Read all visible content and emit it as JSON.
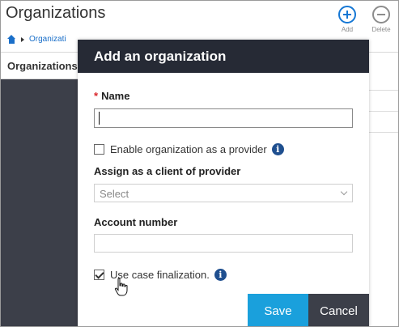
{
  "page": {
    "title": "Organizations",
    "breadcrumb": "Organizati",
    "side_tab": "Organizations"
  },
  "toolbar": {
    "add_label": "Add",
    "delete_label": "Delete"
  },
  "modal": {
    "title": "Add an organization",
    "name_label": "Name",
    "required_mark": "*",
    "name_value": "",
    "enable_provider_label": "Enable organization as a provider",
    "enable_provider_checked": false,
    "assign_client_label": "Assign as a client of provider",
    "assign_client_selected": "Select",
    "account_number_label": "Account number",
    "account_number_value": "",
    "case_finalization_label": "Use case finalization.",
    "case_finalization_checked": true,
    "save_label": "Save",
    "cancel_label": "Cancel"
  },
  "colors": {
    "header_bg": "#262a35",
    "save_bg": "#1aa0dc",
    "cancel_bg": "#3c3f49",
    "info_icon": "#1f4f8f",
    "add_icon": "#1577d4"
  },
  "icons": {
    "add": "add-circle-icon",
    "delete": "delete-circle-icon",
    "home": "home-icon",
    "info": "info-icon",
    "dropdown": "chevron-down-icon",
    "cursor": "hand-pointer-icon"
  }
}
